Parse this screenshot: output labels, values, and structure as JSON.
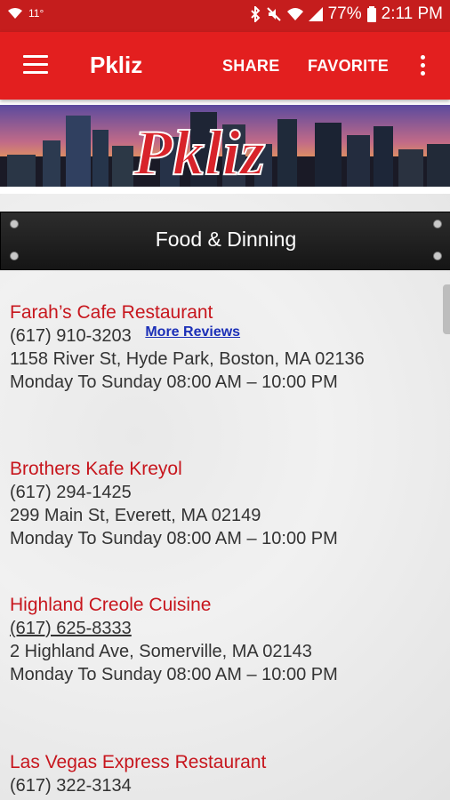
{
  "status_bar": {
    "temp": "11°",
    "battery": "77%",
    "time": "2:11 PM"
  },
  "app_bar": {
    "title": "Pkliz",
    "share_label": "SHARE",
    "favorite_label": "FAVORITE"
  },
  "banner": {
    "logo_text": "Pkliz"
  },
  "section": {
    "title": "Food & Dinning"
  },
  "listings": [
    {
      "name": "Farah’s Cafe Restaurant",
      "phone": "(617) 910-3203",
      "link": "More Reviews",
      "address": "1158 River St, Hyde Park, Boston, MA 02136",
      "hours": "Monday To Sunday 08:00 AM – 10:00 PM"
    },
    {
      "name": "Brothers Kafe Kreyol",
      "phone": "(617) 294-1425",
      "address": "299 Main St, Everett, MA 02149",
      "hours": "Monday To Sunday 08:00 AM – 10:00 PM"
    },
    {
      "name": "Highland Creole Cuisine",
      "phone": "(617) 625-8333",
      "address": "2 Highland Ave, Somerville, MA 02143",
      "hours": "Monday To Sunday 08:00 AM – 10:00 PM"
    },
    {
      "name": "Las Vegas Express Restaurant",
      "phone": "(617) 322-3134"
    }
  ],
  "colors": {
    "primary": "#e31f1f",
    "status": "#c51d1d",
    "listing_name": "#c7161d",
    "link": "#1b2fb7"
  }
}
